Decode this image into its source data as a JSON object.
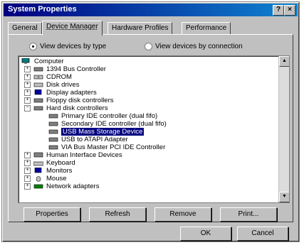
{
  "window": {
    "title": "System Properties",
    "help_glyph": "?",
    "close_glyph": "×"
  },
  "tabs": [
    "General",
    "Device Manager",
    "Hardware Profiles",
    "Performance"
  ],
  "view": {
    "by_type": "View devices by type",
    "by_connection": "View devices by connection",
    "selected": "by_type"
  },
  "tree": [
    {
      "label": "Computer",
      "icon": "computer-icon"
    },
    {
      "label": "1394 Bus Controller",
      "icon": "bus-controller-icon"
    },
    {
      "label": "CDROM",
      "icon": "cdrom-icon"
    },
    {
      "label": "Disk drives",
      "icon": "disk-drive-icon"
    },
    {
      "label": "Display adapters",
      "icon": "display-adapter-icon"
    },
    {
      "label": "Floppy disk controllers",
      "icon": "floppy-controller-icon"
    },
    {
      "label": "Hard disk controllers",
      "icon": "hard-disk-controller-icon"
    },
    {
      "label": "Primary IDE controller (dual fifo)",
      "icon": "ide-controller-icon"
    },
    {
      "label": "Secondary IDE controller (dual fifo)",
      "icon": "ide-controller-icon"
    },
    {
      "label": "USB Mass Storage Device",
      "icon": "usb-storage-icon"
    },
    {
      "label": "USB to ATAPI Adapter",
      "icon": "usb-adapter-icon"
    },
    {
      "label": "VIA Bus Master PCI IDE Controller",
      "icon": "ide-controller-icon"
    },
    {
      "label": "Human Interface Devices",
      "icon": "hid-icon"
    },
    {
      "label": "Keyboard",
      "icon": "keyboard-icon"
    },
    {
      "label": "Monitors",
      "icon": "monitor-icon"
    },
    {
      "label": "Mouse",
      "icon": "mouse-icon"
    },
    {
      "label": "Network adapters",
      "icon": "network-adapter-icon"
    }
  ],
  "actions": {
    "properties": "Properties",
    "refresh": "Refresh",
    "remove": "Remove",
    "print": "Print..."
  },
  "dialog": {
    "ok": "OK",
    "cancel": "Cancel"
  },
  "colors": {
    "title_bar": "#000080",
    "selection": "#000080",
    "face": "#c0c0c0"
  }
}
